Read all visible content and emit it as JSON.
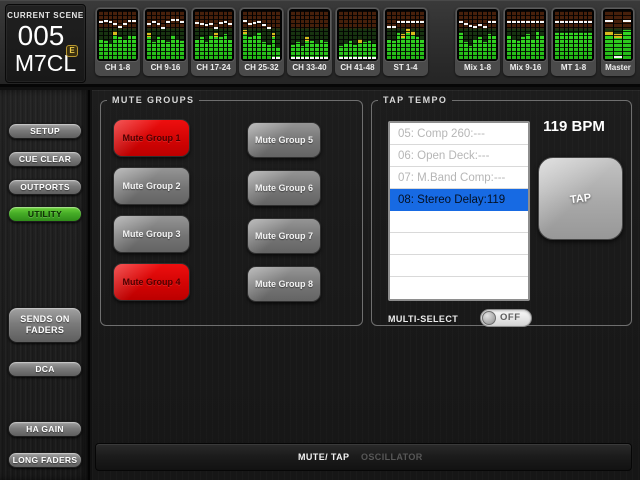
{
  "scene": {
    "section_label": "CURRENT SCENE",
    "number": "005",
    "edit_badge": "E",
    "console_name": "M7CL"
  },
  "meters": {
    "blocks": [
      {
        "label": "CH 1-8",
        "bars": [
          {
            "l": 0.42,
            "f": 0.78
          },
          {
            "l": 0.38,
            "f": 0.8
          },
          {
            "l": 0.33,
            "f": 0.78
          },
          {
            "l": 0.58,
            "f": 0.72,
            "p": true
          },
          {
            "l": 0.45,
            "f": 0.66
          },
          {
            "l": 0.4,
            "f": 0.72
          },
          {
            "l": 0.5,
            "f": 0.8
          },
          {
            "l": 0.47,
            "f": 0.8
          }
        ]
      },
      {
        "label": "CH 9-16",
        "bars": [
          {
            "l": 0.55,
            "f": 0.72,
            "p": true
          },
          {
            "l": 0.35,
            "f": 0.78
          },
          {
            "l": 0.45,
            "f": 0.72
          },
          {
            "l": 0.4,
            "f": 0.65
          },
          {
            "l": 0.35,
            "f": 0.78
          },
          {
            "l": 0.5,
            "f": 0.82
          },
          {
            "l": 0.42,
            "f": 0.82
          },
          {
            "l": 0.38,
            "f": 0.78
          }
        ]
      },
      {
        "label": "CH 17-24",
        "bars": [
          {
            "l": 0.4,
            "f": 0.75
          },
          {
            "l": 0.45,
            "f": 0.72
          },
          {
            "l": 0.35,
            "f": 0.7
          },
          {
            "l": 0.5,
            "f": 0.72
          },
          {
            "l": 0.55,
            "f": 0.65,
            "p": true
          },
          {
            "l": 0.45,
            "f": 0.75
          },
          {
            "l": 0.52,
            "f": 0.78
          },
          {
            "l": 0.4,
            "f": 0.72
          }
        ]
      },
      {
        "label": "CH 25-32",
        "bars": [
          {
            "l": 0.6,
            "f": 0.8,
            "p": true
          },
          {
            "l": 0.45,
            "f": 0.72
          },
          {
            "l": 0.5,
            "f": 0.75
          },
          {
            "l": 0.55,
            "f": 0.78
          },
          {
            "l": 0.35,
            "f": 0.7
          },
          {
            "l": 0.3,
            "f": 0.65
          },
          {
            "l": 0.55,
            "f": 0.02,
            "p": true
          },
          {
            "l": 0.25,
            "f": 0.02
          }
        ]
      },
      {
        "label": "CH 33-40",
        "bars": [
          {
            "l": 0.3,
            "f": 0.02
          },
          {
            "l": 0.35,
            "f": 0.02
          },
          {
            "l": 0.28,
            "f": 0.02
          },
          {
            "l": 0.45,
            "f": 0.02,
            "p": true
          },
          {
            "l": 0.38,
            "f": 0.02
          },
          {
            "l": 0.33,
            "f": 0.02
          },
          {
            "l": 0.4,
            "f": 0.02
          },
          {
            "l": 0.35,
            "f": 0.02
          }
        ]
      },
      {
        "label": "CH 41-48",
        "bars": [
          {
            "l": 0.28,
            "f": 0.02
          },
          {
            "l": 0.33,
            "f": 0.02
          },
          {
            "l": 0.38,
            "f": 0.02
          },
          {
            "l": 0.3,
            "f": 0.02
          },
          {
            "l": 0.42,
            "f": 0.02,
            "p": true
          },
          {
            "l": 0.35,
            "f": 0.02
          },
          {
            "l": 0.38,
            "f": 0.02
          },
          {
            "l": 0.32,
            "f": 0.02
          }
        ]
      },
      {
        "label": "ST 1-4",
        "bars": [
          {
            "l": 0.4,
            "f": 0.66
          },
          {
            "l": 0.38,
            "f": 0.66
          },
          {
            "l": 0.55,
            "f": 0.78
          },
          {
            "l": 0.52,
            "f": 0.78,
            "p": true
          },
          {
            "l": 0.62,
            "f": 0.78,
            "p": true
          },
          {
            "l": 0.58,
            "f": 0.78,
            "p": true
          },
          {
            "l": 0.45,
            "f": 0.78
          },
          {
            "l": 0.42,
            "f": 0.78
          }
        ]
      },
      {
        "label": "Mix 1-8",
        "bars": [
          {
            "l": 0.55,
            "f": 0.78
          },
          {
            "l": 0.35,
            "f": 0.72
          },
          {
            "l": 0.28,
            "f": 0.68
          },
          {
            "l": 0.42,
            "f": 0.66
          },
          {
            "l": 0.45,
            "f": 0.7
          },
          {
            "l": 0.35,
            "f": 0.66
          },
          {
            "l": 0.52,
            "f": 0.78
          },
          {
            "l": 0.48,
            "f": 0.78
          }
        ]
      },
      {
        "label": "Mix 9-16",
        "bars": [
          {
            "l": 0.5,
            "f": 0.78
          },
          {
            "l": 0.42,
            "f": 0.78
          },
          {
            "l": 0.38,
            "f": 0.78
          },
          {
            "l": 0.45,
            "f": 0.78
          },
          {
            "l": 0.52,
            "f": 0.78
          },
          {
            "l": 0.42,
            "f": 0.78
          },
          {
            "l": 0.56,
            "f": 0.78
          },
          {
            "l": 0.5,
            "f": 0.78
          }
        ]
      },
      {
        "label": "MT 1-8",
        "bars": [
          {
            "l": 0.55,
            "f": 0.78
          },
          {
            "l": 0.55,
            "f": 0.78
          },
          {
            "l": 0.55,
            "f": 0.78
          },
          {
            "l": 0.55,
            "f": 0.78
          },
          {
            "l": 0.55,
            "f": 0.78
          },
          {
            "l": 0.55,
            "f": 0.78
          },
          {
            "l": 0.55,
            "f": 0.78
          },
          {
            "l": 0.55,
            "f": 0.78
          }
        ]
      },
      {
        "label": "Master",
        "bars": [
          {
            "l": 0.58,
            "f": 0.8,
            "p": true
          },
          {
            "l": 0.52,
            "f": 0.05,
            "p": true
          },
          {
            "l": 0.6,
            "f": 0.8
          }
        ]
      }
    ]
  },
  "sidebar": {
    "buttons": [
      {
        "label": "SETUP",
        "active": false,
        "large": false
      },
      {
        "label": "CUE CLEAR",
        "active": false,
        "large": false
      },
      {
        "label": "OUTPORTS",
        "active": false,
        "large": false
      },
      {
        "label": "UTILITY",
        "active": true,
        "large": false
      },
      {
        "label": "SENDS ON FADERS",
        "active": false,
        "large": true
      },
      {
        "label": "DCA",
        "active": false,
        "large": false
      },
      {
        "label": "HA GAIN",
        "active": false,
        "large": false
      },
      {
        "label": "LONG FADERS",
        "active": false,
        "large": false
      }
    ]
  },
  "mute_groups": {
    "title": "MUTE GROUPS",
    "buttons": [
      {
        "label": "Mute Group 1",
        "active": true
      },
      {
        "label": "Mute Group 2",
        "active": false
      },
      {
        "label": "Mute Group 3",
        "active": false
      },
      {
        "label": "Mute Group 4",
        "active": true
      },
      {
        "label": "Mute Group 5",
        "active": false
      },
      {
        "label": "Mute Group 6",
        "active": false
      },
      {
        "label": "Mute Group 7",
        "active": false
      },
      {
        "label": "Mute Group 8",
        "active": false
      }
    ]
  },
  "tap_tempo": {
    "title": "TAP TEMPO",
    "bpm_display": "119 BPM",
    "tap_button_label": "TAP",
    "multi_select_label": "MULTI-SELECT",
    "toggle_state": "OFF",
    "list": [
      {
        "text": "05: Comp 260:---",
        "state": "dimmed"
      },
      {
        "text": "06: Open Deck:---",
        "state": "dimmed"
      },
      {
        "text": "07: M.Band Comp:---",
        "state": "dimmed"
      },
      {
        "text": "08: Stereo Delay:119",
        "state": "selected"
      },
      {
        "text": "",
        "state": "empty"
      },
      {
        "text": "",
        "state": "empty"
      },
      {
        "text": "",
        "state": "empty"
      },
      {
        "text": "",
        "state": "empty"
      }
    ]
  },
  "footer": {
    "tabs": [
      {
        "label": "MUTE/ TAP",
        "active": true
      },
      {
        "label": "OSCILLATOR",
        "active": false
      }
    ]
  },
  "colors": {
    "accent_green": "#46ad27",
    "mute_red": "#d20404",
    "selection_blue": "#176ae3",
    "meter_green": "#2bc91c",
    "peak_yellow": "#d9bb1e",
    "edit_badge_gold": "#e9c94b"
  }
}
